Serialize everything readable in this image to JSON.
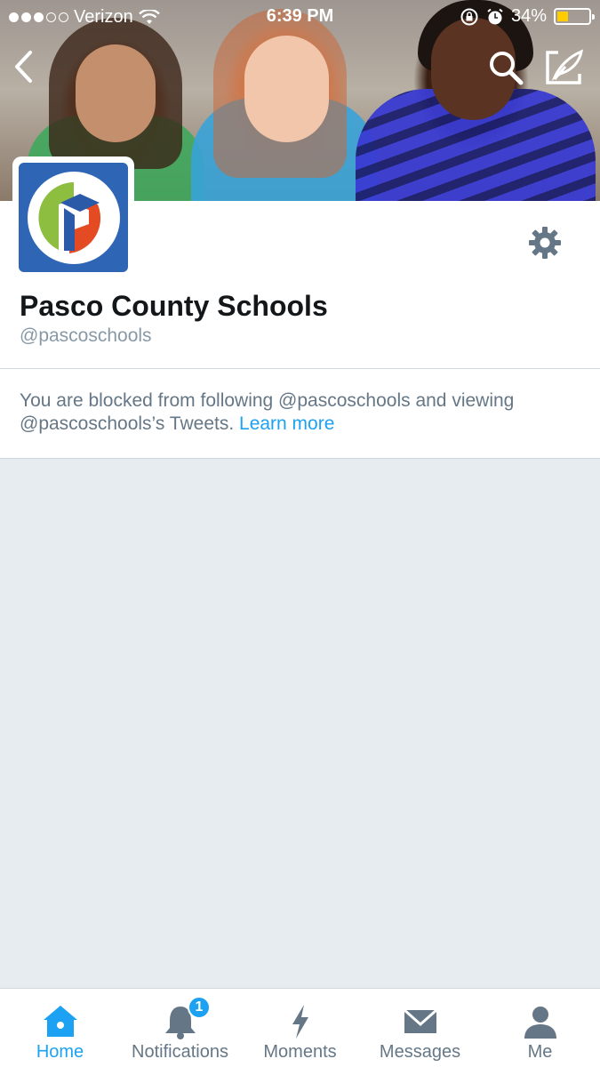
{
  "status_bar": {
    "carrier": "Verizon",
    "time": "6:39 PM",
    "battery_percent": "34%",
    "battery_level": 0.34,
    "signal_bars_filled": 3,
    "signal_bars_total": 5
  },
  "header": {
    "back_icon": "chevron-left-icon",
    "search_icon": "search-icon",
    "compose_icon": "compose-icon"
  },
  "profile": {
    "name": "Pasco County Schools",
    "handle": "@pascoschools",
    "settings_icon": "gear-icon"
  },
  "blocked": {
    "message": "You are blocked from following @pascoschools and viewing @pascoschools’s Tweets.",
    "link_label": "Learn more"
  },
  "tabbar": {
    "tabs": [
      {
        "label": "Home",
        "icon": "home-icon",
        "active": true
      },
      {
        "label": "Notifications",
        "icon": "bell-icon",
        "badge": "1"
      },
      {
        "label": "Moments",
        "icon": "lightning-icon"
      },
      {
        "label": "Messages",
        "icon": "envelope-icon"
      },
      {
        "label": "Me",
        "icon": "person-icon"
      }
    ]
  },
  "colors": {
    "accent": "#1da1f2",
    "text_primary": "#14171a",
    "text_secondary": "#657786",
    "background": "#e6ecf0"
  }
}
